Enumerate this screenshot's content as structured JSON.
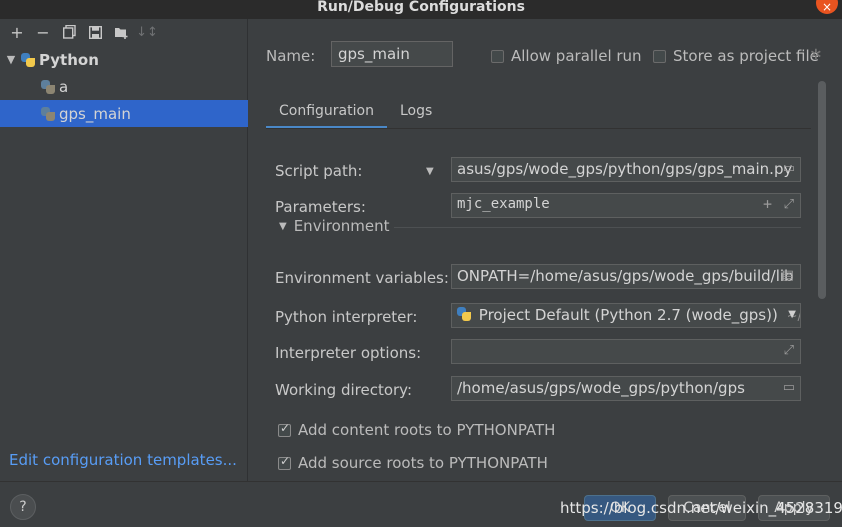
{
  "window": {
    "title": "Run/Debug Configurations",
    "close_glyph": "×"
  },
  "toolbar": {
    "add": "+",
    "remove": "−",
    "copy_icon": "copy-icon",
    "save_icon": "save-icon",
    "folder_icon": "new-folder-icon",
    "sort_icon": "sort-icon"
  },
  "tree": {
    "root": {
      "label": "Python",
      "expanded": true
    },
    "items": [
      {
        "label": "a",
        "selected": false
      },
      {
        "label": "gps_main",
        "selected": true
      }
    ]
  },
  "edit_templates": "Edit configuration templates...",
  "config": {
    "name_label": "Name:",
    "name_value": "gps_main",
    "allow_parallel": {
      "label": "Allow parallel run",
      "checked": false
    },
    "store_as_project": {
      "label": "Store as project file",
      "checked": false
    }
  },
  "tabs": [
    {
      "label": "Configuration",
      "active": true
    },
    {
      "label": "Logs",
      "active": false
    }
  ],
  "form": {
    "script_path": {
      "label": "Script path:",
      "value": "asus/gps/wode_gps/python/gps/gps_main.py"
    },
    "parameters": {
      "label": "Parameters:",
      "value": "mjc_example"
    },
    "environment_header": "Environment",
    "env_vars": {
      "label": "Environment variables:",
      "value": "ONPATH=/home/asus/gps/wode_gps/build/lib"
    },
    "interpreter": {
      "label": "Python interpreter:",
      "value": "Project Default (Python 2.7 (wode_gps))",
      "hint": "~/gp"
    },
    "interp_options": {
      "label": "Interpreter options:",
      "value": ""
    },
    "working_dir": {
      "label": "Working directory:",
      "value": "/home/asus/gps/wode_gps/python/gps"
    },
    "add_content_roots": {
      "label": "Add content roots to PYTHONPATH",
      "checked": true
    },
    "add_source_roots": {
      "label": "Add source roots to PYTHONPATH",
      "checked": true
    }
  },
  "footer": {
    "help": "?",
    "ok": "OK",
    "cancel": "Cancel",
    "apply": "Apply",
    "watermark": "https://blog.csdn.net/weixin_45283197"
  },
  "colors": {
    "accent": "#2f65ca",
    "link": "#589df6",
    "background": "#3c3f41"
  }
}
